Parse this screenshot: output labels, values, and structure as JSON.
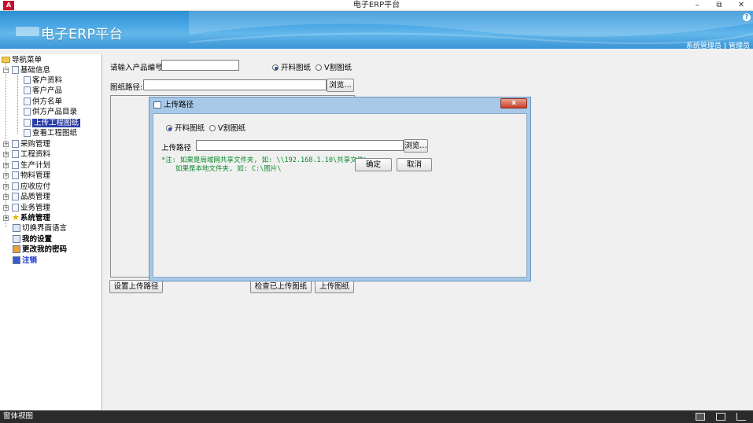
{
  "window": {
    "title": "电子ERP平台",
    "app_icon": "A",
    "minimize": "–",
    "restore": "⧉",
    "close": "✕"
  },
  "banner": {
    "title": "电子ERP平台",
    "help": "?",
    "link_admin": "系统管理员",
    "link_separator": "|",
    "link_user": "管理员"
  },
  "nav": {
    "root": "导航菜单",
    "basic_info": "基础信息",
    "basic_children": [
      "客户资料",
      "客户产品",
      "供方名单",
      "供方产品目录",
      "上传工程图纸",
      "查看工程图纸"
    ],
    "groups": [
      "采购管理",
      "工程资料",
      "生产计划",
      "物料管理",
      "应收应付",
      "品质管理",
      "业务管理"
    ],
    "system_manage": "系统管理",
    "switch_lang": "切换界面语言",
    "my_settings": "我的设置",
    "change_password": "更改我的密码",
    "logout": "注销"
  },
  "form": {
    "product_label": "请输入产品编号",
    "product_value": "",
    "radio_open": "开料图纸",
    "radio_v": "V割图纸",
    "path_label": "图纸路径:",
    "path_value": "",
    "browse": "浏览…",
    "set_path_button": "设置上传路径",
    "check_uploaded_button": "检查已上传图纸",
    "upload_button": "上传图纸"
  },
  "dialog": {
    "title": "上传路径",
    "radio_open": "开料图纸",
    "radio_v": "V割图纸",
    "path_label": "上传路径",
    "path_value": "",
    "browse": "浏览…",
    "note_line1": "*注: 如果是局域网共享文件夹, 如: \\\\192.168.1.10\\共享文件\\",
    "note_line2": "如果是本地文件夹, 如: C:\\图片\\",
    "ok": "确定",
    "cancel": "取消",
    "close": "x"
  },
  "status": {
    "text": "窗体视图"
  },
  "colors": {
    "banner": "#4da9e6",
    "selected_nav": "#2a3ea8",
    "note_green": "#0a8a2a",
    "dialog_frame": "#a8c8e8"
  }
}
